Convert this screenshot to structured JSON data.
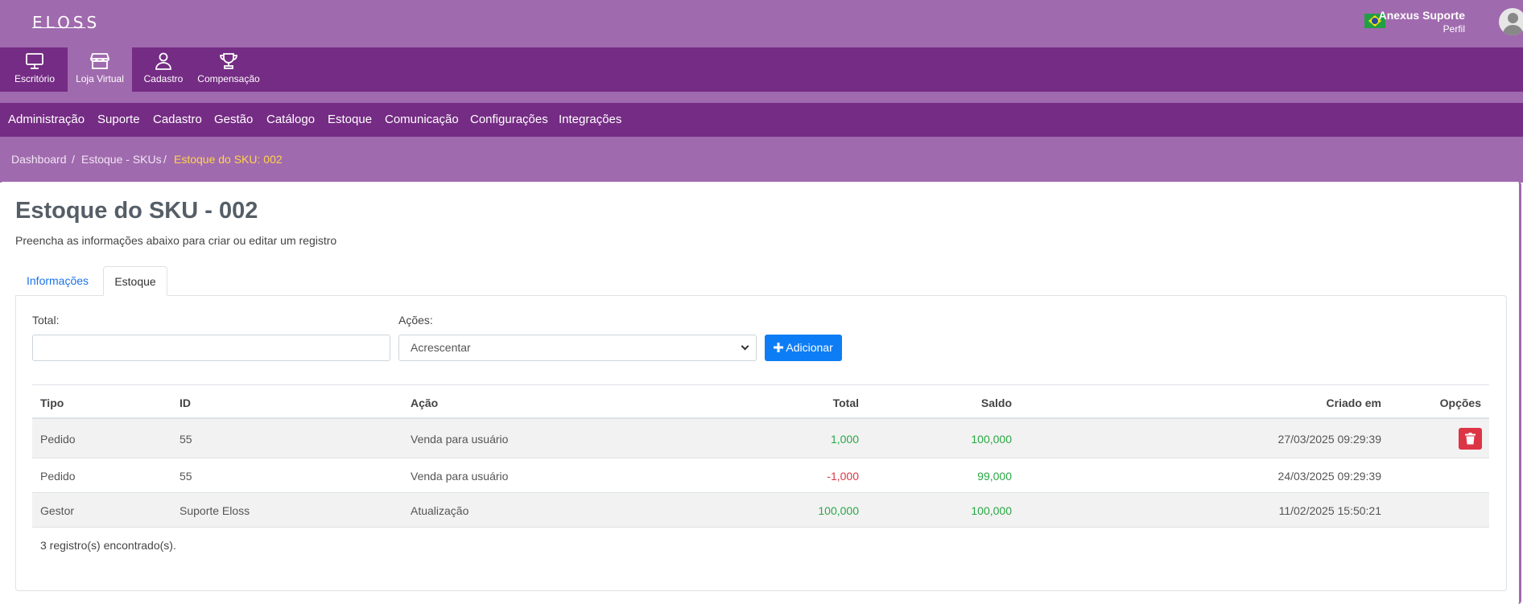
{
  "app": {
    "logo": "ELOSS"
  },
  "user": {
    "name": "Anexus Suporte",
    "link": "Perfil",
    "flag_icon": "brazil-flag-icon",
    "avatar_icon": "user-avatar-icon"
  },
  "modules": [
    {
      "label": "Escritório",
      "icon": "desktop-icon",
      "active": false
    },
    {
      "label": "Loja Virtual",
      "icon": "store-icon",
      "active": true
    },
    {
      "label": "Cadastro",
      "icon": "user-icon",
      "active": false
    },
    {
      "label": "Compensação",
      "icon": "trophy-icon",
      "active": false
    }
  ],
  "menu": [
    "Administração",
    "Suporte",
    "Cadastro",
    "Gestão",
    "Catálogo",
    "Estoque",
    "Comunicação",
    "Configurações",
    "Integrações"
  ],
  "breadcrumb": {
    "items": [
      "Dashboard",
      "Estoque - SKUs"
    ],
    "current": "Estoque do SKU: 002",
    "separator": "/"
  },
  "page": {
    "title": "Estoque do SKU - 002",
    "subtitle": "Preencha as informações abaixo para criar ou editar um registro"
  },
  "tabs": [
    {
      "label": "Informações",
      "active": false
    },
    {
      "label": "Estoque",
      "active": true
    }
  ],
  "form": {
    "total_label": "Total:",
    "total_value": "",
    "acoes_label": "Ações:",
    "acoes_selected": "Acrescentar",
    "add_button": "Adicionar",
    "add_icon": "plus-icon"
  },
  "table": {
    "headers": {
      "tipo": "Tipo",
      "id": "ID",
      "acao": "Ação",
      "total": "Total",
      "saldo": "Saldo",
      "criado": "Criado em",
      "opcoes": "Opções"
    },
    "rows": [
      {
        "tipo": "Pedido",
        "id": "55",
        "acao": "Venda para usuário",
        "total": "1,000",
        "saldo": "100,000",
        "criado": "27/03/2025 09:29:39",
        "delete": true
      },
      {
        "tipo": "Pedido",
        "id": "55",
        "acao": "Venda para usuário",
        "total": "-1,000",
        "saldo": "99,000",
        "criado": "24/03/2025 09:29:39",
        "delete": false
      },
      {
        "tipo": "Gestor",
        "id": "Suporte Eloss",
        "acao": "Atualização",
        "total": "100,000",
        "saldo": "100,000",
        "criado": "11/02/2025 15:50:21",
        "delete": false
      }
    ],
    "footer": "3 registro(s) encontrado(s).",
    "delete_icon": "trash-icon"
  },
  "colors": {
    "header_bg": "#a06aae",
    "nav_bg": "#752c84",
    "breadcrumb_current": "#ffd44a",
    "primary_button": "#0d7df5",
    "danger_button": "#dc3545",
    "positive_value": "#28a745",
    "negative_value": "#dc3545"
  }
}
